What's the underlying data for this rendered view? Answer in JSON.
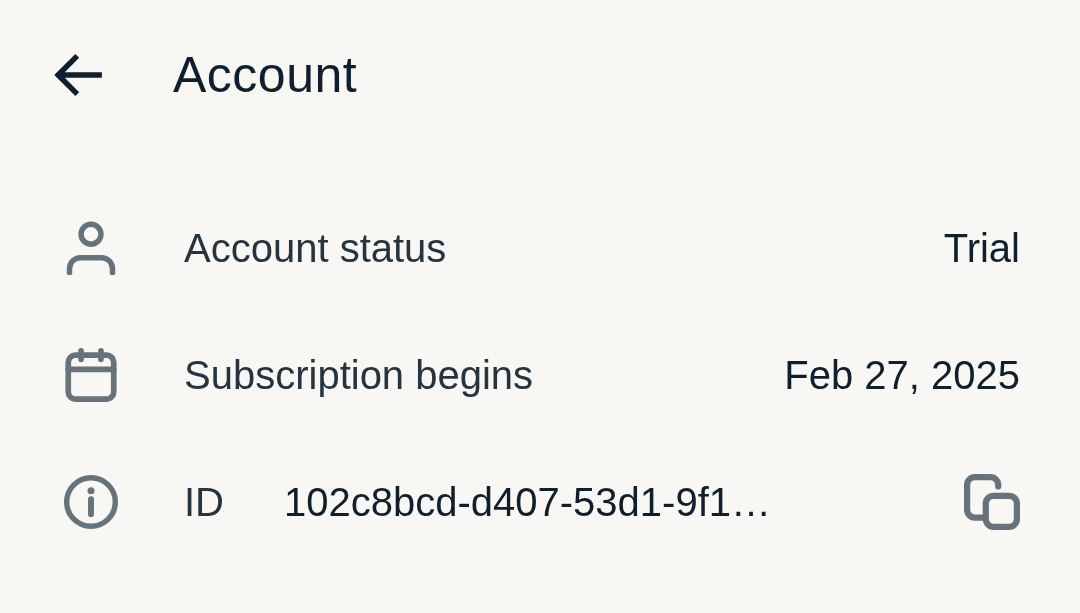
{
  "header": {
    "title": "Account"
  },
  "rows": [
    {
      "kind": "plain",
      "label": "Account status",
      "value": "Trial"
    },
    {
      "kind": "plain",
      "label": "Subscription begins",
      "value": "Feb 27, 2025"
    },
    {
      "kind": "copyable",
      "label": "ID",
      "value": "102c8bcd-d407-53d1-9f1…"
    }
  ]
}
